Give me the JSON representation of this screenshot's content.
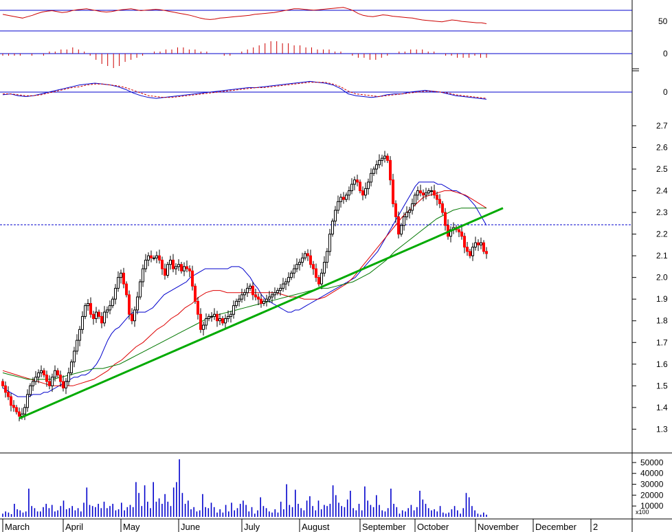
{
  "chart_data": {
    "type": "candlestick",
    "colors": {
      "up_candle": "#ffffff",
      "down_candle": "#ff0000",
      "candle_outline": "#000000",
      "ma_fast": "#0000cc",
      "ma_mid": "#dd0000",
      "ma_slow": "#007700",
      "trendline": "#00aa00",
      "reference_line": "#0000cc",
      "volume_bar": "#0000cc",
      "rsi_line": "#cc0000",
      "macd_line": "#0000cc",
      "signal_line": "#cc0000",
      "histogram": "#cc0000"
    },
    "price_axis": {
      "ticks": [
        "1.3",
        "1.4",
        "1.5",
        "1.6",
        "1.7",
        "1.8",
        "1.9",
        "2.0",
        "2.1",
        "2.2",
        "2.3",
        "2.4",
        "2.5",
        "2.6",
        "2.7"
      ],
      "ylim": [
        1.26,
        2.76
      ],
      "reference_level": 2.1
    },
    "volume_axis": {
      "ticks": [
        "10000",
        "20000",
        "30000",
        "40000",
        "50000"
      ],
      "multiplier_label": "x100",
      "ylim": [
        0,
        55000
      ]
    },
    "rsi_axis": {
      "ticks": [
        "50"
      ],
      "levels": [
        70,
        30
      ],
      "ylim": [
        20,
        85
      ]
    },
    "macd_hist_axis": {
      "ticks": [
        "0"
      ]
    },
    "macd_axis": {
      "ticks": [
        "0"
      ]
    },
    "x_labels": [
      "March",
      "April",
      "May",
      "June",
      "July",
      "August",
      "September",
      "October",
      "November",
      "December",
      "2"
    ],
    "month_start_index": [
      0,
      22,
      43,
      64,
      87,
      108,
      130,
      150,
      172,
      193,
      214
    ],
    "trendlines": [
      {
        "from": {
          "i": 6,
          "price": 1.35
        },
        "to": {
          "i": 182,
          "price": 2.32
        }
      }
    ],
    "close": [
      1.5,
      1.47,
      1.45,
      1.41,
      1.4,
      1.38,
      1.36,
      1.37,
      1.4,
      1.46,
      1.5,
      1.52,
      1.54,
      1.56,
      1.57,
      1.55,
      1.52,
      1.5,
      1.54,
      1.57,
      1.55,
      1.52,
      1.49,
      1.52,
      1.56,
      1.61,
      1.66,
      1.71,
      1.76,
      1.82,
      1.87,
      1.88,
      1.83,
      1.81,
      1.84,
      1.82,
      1.79,
      1.84,
      1.85,
      1.87,
      1.9,
      1.95,
      2.0,
      2.02,
      1.97,
      1.92,
      1.83,
      1.8,
      1.85,
      1.91,
      1.98,
      2.04,
      2.08,
      2.1,
      2.09,
      2.09,
      2.1,
      2.08,
      2.04,
      2.01,
      2.06,
      2.08,
      2.04,
      2.05,
      2.06,
      2.03,
      2.05,
      2.04,
      2.03,
      1.96,
      1.89,
      1.83,
      1.76,
      1.78,
      1.81,
      1.82,
      1.82,
      1.83,
      1.8,
      1.81,
      1.79,
      1.81,
      1.82,
      1.83,
      1.87,
      1.89,
      1.9,
      1.92,
      1.93,
      1.95,
      1.96,
      1.92,
      1.91,
      1.9,
      1.88,
      1.89,
      1.9,
      1.91,
      1.92,
      1.93,
      1.94,
      1.95,
      1.97,
      1.98,
      2.0,
      2.02,
      2.04,
      2.06,
      2.07,
      2.09,
      2.11,
      2.1,
      2.06,
      2.04,
      2.0,
      1.97,
      2.02,
      2.07,
      2.12,
      2.2,
      2.26,
      2.31,
      2.35,
      2.37,
      2.36,
      2.38,
      2.4,
      2.43,
      2.45,
      2.44,
      2.4,
      2.38,
      2.41,
      2.44,
      2.48,
      2.5,
      2.52,
      2.54,
      2.55,
      2.56,
      2.54,
      2.45,
      2.34,
      2.28,
      2.2,
      2.24,
      2.28,
      2.3,
      2.31,
      2.34,
      2.38,
      2.4,
      2.39,
      2.38,
      2.39,
      2.4,
      2.4,
      2.38,
      2.36,
      2.34,
      2.3,
      2.24,
      2.19,
      2.22,
      2.23,
      2.22,
      2.21,
      2.19,
      2.14,
      2.12,
      2.1,
      2.14,
      2.16,
      2.15,
      2.16,
      2.12,
      2.11
    ],
    "ma_fast": [
      1.49,
      1.48,
      1.47,
      1.46,
      1.45,
      1.45,
      1.45,
      1.45,
      1.46,
      1.46,
      1.46,
      1.47,
      1.47,
      1.48,
      1.49,
      1.5,
      1.51,
      1.52,
      1.53,
      1.54,
      1.54,
      1.55,
      1.55,
      1.56,
      1.58,
      1.6,
      1.63,
      1.67,
      1.71,
      1.74,
      1.76,
      1.77,
      1.79,
      1.81,
      1.83,
      1.84,
      1.84,
      1.84,
      1.84,
      1.85,
      1.86,
      1.88,
      1.9,
      1.92,
      1.93,
      1.94,
      1.95,
      1.96,
      1.97,
      1.98,
      2.0,
      2.01,
      2.02,
      2.03,
      2.04,
      2.04,
      2.04,
      2.04,
      2.04,
      2.04,
      2.04,
      2.05,
      2.05,
      2.05,
      2.04,
      2.02,
      2.0,
      1.97,
      1.95,
      1.92,
      1.9,
      1.89,
      1.88,
      1.87,
      1.86,
      1.85,
      1.84,
      1.84,
      1.85,
      1.85,
      1.86,
      1.87,
      1.88,
      1.89,
      1.9,
      1.91,
      1.92,
      1.93,
      1.94,
      1.95,
      1.96,
      1.97,
      1.98,
      1.99,
      2.0,
      2.02,
      2.04,
      2.06,
      2.08,
      2.1,
      2.12,
      2.15,
      2.18,
      2.21,
      2.24,
      2.27,
      2.3,
      2.33,
      2.36,
      2.39,
      2.42,
      2.44,
      2.44,
      2.44,
      2.44,
      2.44,
      2.43,
      2.43,
      2.42,
      2.41,
      2.4,
      2.4,
      2.39,
      2.38,
      2.37,
      2.35,
      2.33,
      2.3,
      2.27,
      2.24
    ],
    "ma_mid": [
      1.57,
      1.56,
      1.55,
      1.54,
      1.53,
      1.52,
      1.51,
      1.5,
      1.5,
      1.5,
      1.5,
      1.51,
      1.52,
      1.53,
      1.55,
      1.57,
      1.6,
      1.62,
      1.65,
      1.68,
      1.7,
      1.73,
      1.76,
      1.78,
      1.81,
      1.83,
      1.86,
      1.88,
      1.91,
      1.93,
      1.94,
      1.94,
      1.93,
      1.93,
      1.93,
      1.93,
      1.93,
      1.93,
      1.93,
      1.93,
      1.92,
      1.91,
      1.91,
      1.9,
      1.9,
      1.9,
      1.91,
      1.93,
      1.95,
      1.97,
      2.0,
      2.04,
      2.08,
      2.12,
      2.16,
      2.2,
      2.24,
      2.28,
      2.31,
      2.34,
      2.37,
      2.38,
      2.39,
      2.4,
      2.4,
      2.39,
      2.38,
      2.36,
      2.34,
      2.32
    ],
    "ma_slow": [
      1.56,
      1.55,
      1.54,
      1.53,
      1.53,
      1.53,
      1.53,
      1.54,
      1.55,
      1.56,
      1.57,
      1.58,
      1.58,
      1.59,
      1.6,
      1.62,
      1.64,
      1.66,
      1.68,
      1.7,
      1.72,
      1.74,
      1.76,
      1.78,
      1.8,
      1.82,
      1.83,
      1.84,
      1.85,
      1.86,
      1.87,
      1.88,
      1.89,
      1.9,
      1.91,
      1.92,
      1.93,
      1.94,
      1.95,
      1.95,
      1.96,
      1.97,
      1.98,
      2.0,
      2.02,
      2.05,
      2.08,
      2.12,
      2.15,
      2.18,
      2.21,
      2.24,
      2.27,
      2.29,
      2.31,
      2.32,
      2.32,
      2.32,
      2.32
    ],
    "volume": [
      3000,
      5000,
      4000,
      2500,
      12000,
      7000,
      6000,
      4000,
      5000,
      26000,
      10000,
      8000,
      5000,
      5000,
      9000,
      12000,
      8000,
      11000,
      5000,
      6000,
      10000,
      15000,
      7000,
      8000,
      10000,
      6000,
      8000,
      5000,
      13000,
      27000,
      11000,
      10000,
      9000,
      12000,
      8000,
      14000,
      8000,
      10000,
      12000,
      6000,
      7000,
      13000,
      6000,
      9000,
      11000,
      9000,
      32000,
      22000,
      10000,
      29000,
      14000,
      8000,
      32000,
      14000,
      17000,
      12000,
      21000,
      14000,
      10000,
      27000,
      32000,
      53000,
      22000,
      12000,
      15000,
      7000,
      9000,
      5000,
      6000,
      21000,
      9000,
      8000,
      13000,
      9000,
      4000,
      7000,
      4000,
      11000,
      5000,
      13000,
      6000,
      8000,
      12000,
      15000,
      11000,
      5000,
      9000,
      3000,
      6000,
      18000,
      10000,
      8000,
      5000,
      4000,
      7000,
      4000,
      14000,
      7000,
      30000,
      11000,
      9000,
      25000,
      12000,
      8000,
      6000,
      15000,
      19000,
      10000,
      6000,
      15000,
      7000,
      11000,
      10000,
      12000,
      29000,
      20000,
      13000,
      10000,
      9000,
      16000,
      24000,
      8000,
      6000,
      12000,
      6000,
      28000,
      15000,
      11000,
      9000,
      20000,
      11000,
      6000,
      5000,
      8000,
      26000,
      12000,
      9000,
      3000,
      6000,
      5000,
      8000,
      11000,
      6000,
      9000,
      24000,
      16000,
      12000,
      8000,
      6000,
      7000,
      5000,
      10000,
      4000,
      3000,
      4000,
      7000,
      10000,
      6000,
      3000,
      8000,
      22000,
      18000,
      10000,
      6000,
      3000,
      2000,
      4000,
      2000
    ],
    "rsi": [
      60,
      58,
      56,
      54,
      52,
      55,
      58,
      62,
      65,
      67,
      68,
      66,
      64,
      65,
      68,
      70,
      71,
      72,
      70,
      68,
      66,
      65,
      66,
      68,
      70,
      71,
      72,
      70,
      68,
      69,
      70,
      71,
      70,
      68,
      66,
      64,
      62,
      60,
      58,
      55,
      52,
      50,
      49,
      50,
      52,
      53,
      54,
      55,
      56,
      57,
      58,
      60,
      61,
      62,
      63,
      64,
      66,
      68,
      70,
      72,
      72,
      71,
      70,
      69,
      70,
      71,
      72,
      73,
      74,
      75,
      72,
      68,
      62,
      58,
      56,
      55,
      57,
      59,
      58,
      56,
      55,
      54,
      53,
      52,
      50,
      48,
      47,
      46,
      45,
      44,
      46,
      48,
      47,
      45,
      44,
      43,
      42,
      42,
      40
    ],
    "macd_hist": [
      -1,
      -1,
      -1,
      -1,
      0,
      -1,
      0,
      -1,
      1,
      1,
      2,
      2,
      3,
      2,
      1,
      -1,
      -3,
      -5,
      -6,
      -7,
      -6,
      -4,
      -3,
      -2,
      -1,
      0,
      1,
      1,
      2,
      2,
      3,
      3,
      2,
      2,
      1,
      1,
      0,
      0,
      -1,
      -1,
      0,
      1,
      2,
      3,
      4,
      5,
      6,
      6,
      5,
      5,
      4,
      4,
      3,
      3,
      2,
      2,
      2,
      1,
      1,
      0,
      -1,
      -2,
      -2,
      -3,
      -3,
      -2,
      -1,
      0,
      1,
      1,
      2,
      2,
      2,
      1,
      1,
      0,
      -1,
      -1,
      -2,
      -2,
      -2,
      -1,
      -2,
      -2
    ],
    "macd": [
      -3,
      -2,
      -4,
      -5,
      -4,
      -2,
      0,
      2,
      4,
      6,
      8,
      9,
      10,
      9,
      8,
      6,
      3,
      -1,
      -4,
      -6,
      -7,
      -6,
      -5,
      -4,
      -3,
      -2,
      -1,
      0,
      1,
      2,
      3,
      4,
      5,
      5,
      6,
      7,
      8,
      9,
      10,
      11,
      12,
      11,
      10,
      8,
      4,
      -2,
      -4,
      -5,
      -6,
      -5,
      -3,
      -2,
      -2,
      0,
      1,
      2,
      1,
      0,
      -2,
      -4,
      -5,
      -6,
      -7,
      -8
    ],
    "signal": [
      -2,
      -2,
      -3,
      -4,
      -4,
      -3,
      -1,
      1,
      3,
      5,
      6,
      8,
      9,
      9,
      8,
      7,
      5,
      2,
      -1,
      -4,
      -5,
      -6,
      -6,
      -5,
      -4,
      -3,
      -2,
      -1,
      0,
      1,
      2,
      3,
      4,
      5,
      5,
      6,
      7,
      8,
      9,
      10,
      11,
      11,
      11,
      9,
      6,
      1,
      -2,
      -3,
      -4,
      -5,
      -4,
      -3,
      -2,
      -1,
      0,
      1,
      1,
      0,
      -1,
      -3,
      -4,
      -5,
      -6,
      -7
    ]
  }
}
